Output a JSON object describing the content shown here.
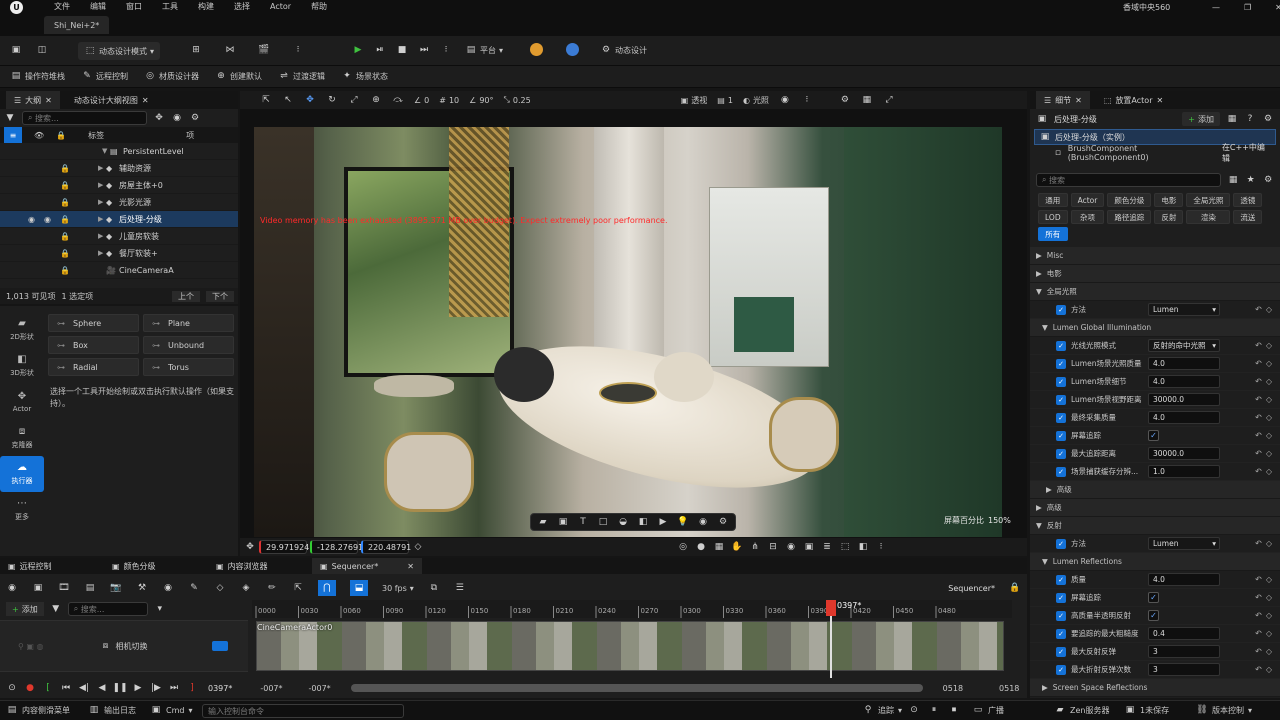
{
  "menu": {
    "items": [
      "文件",
      "编辑",
      "窗口",
      "工具",
      "构建",
      "选择",
      "Actor",
      "帮助"
    ],
    "project": "香域中央560",
    "tab": "Shi_Nei+2*"
  },
  "toolbar": {
    "mode_label": "动态设计模式",
    "platform_label": "平台",
    "dynamic_design_label": "动态设计"
  },
  "toolbar2": {
    "items": [
      "操作符堆栈",
      "远程控制",
      "材质设计器",
      "创建默认",
      "过渡逻辑",
      "场景状态"
    ]
  },
  "outliner": {
    "tab_outline": "大纲",
    "tab_dynamic": "动态设计大纲视图",
    "search_placeholder": "搜索...",
    "col_label": "标签",
    "col_item": "项",
    "rows": [
      {
        "name": "PersistentLevel",
        "indent": 0
      },
      {
        "name": "辅助资源",
        "indent": 1
      },
      {
        "name": "房屋主体+0",
        "indent": 1
      },
      {
        "name": "光影光源",
        "indent": 1
      },
      {
        "name": "后处理-分级",
        "indent": 1,
        "selected": true
      },
      {
        "name": "儿童房软装",
        "indent": 1
      },
      {
        "name": "餐厅软装+",
        "indent": 1
      },
      {
        "name": "CineCameraA",
        "indent": 1
      }
    ],
    "count_text": "1,013 可见项",
    "selected_text": "1 选定项",
    "up_label": "上个",
    "down_label": "下个"
  },
  "modes": {
    "side": [
      {
        "label": "2D形状",
        "icon": "rhombus-icon"
      },
      {
        "label": "3D形状",
        "icon": "cube-icon"
      },
      {
        "label": "Actor",
        "icon": "move-icon"
      },
      {
        "label": "克隆器",
        "icon": "clone-icon"
      },
      {
        "label": "执行器",
        "icon": "cloud-icon",
        "active": true
      },
      {
        "label": "更多",
        "icon": "dots-icon"
      }
    ],
    "shapes": [
      "Sphere",
      "Plane",
      "Box",
      "Unbound",
      "Radial",
      "Torus"
    ],
    "hint": "选择一个工具开始绘制或双击执行默认操作（如果支持）。"
  },
  "viewport": {
    "perspective": "透视",
    "lit": "光照",
    "angle": "90°",
    "snap": "10",
    "rot": "0",
    "scale": "0.25",
    "cam_speed": "1",
    "warning": "Video memory has been exhausted (3895.371 MB over budget). Expect extremely poor performance.",
    "screen_pct_label": "屏幕百分比",
    "screen_pct": "150%",
    "coords": [
      "29.971924",
      "-128.27691",
      "220.48791"
    ]
  },
  "details": {
    "tab_details": "细节",
    "tab_place": "放置Actor",
    "add_label": "添加",
    "actor_name": "后处理-分级（实例）",
    "component": "BrushComponent (BrushComponent0)",
    "edit_cpp": "在C++中编辑",
    "search_placeholder": "搜索",
    "filters": [
      "通用",
      "Actor",
      "颜色分级",
      "电影",
      "全局光照",
      "透镜",
      "LOD",
      "杂项",
      "路径追踪",
      "反射",
      "渲染",
      "流送",
      "所有"
    ],
    "sections": {
      "misc": "Misc",
      "film": "电影",
      "gi": "全局光照",
      "lumen_gi": "Lumen Global Illumination",
      "advanced": "高级",
      "advanced2": "高级",
      "reflection": "反射",
      "lumen_refl": "Lumen Reflections",
      "ssr": "Screen Space Reflections"
    },
    "gi_props": [
      {
        "name": "方法",
        "type": "dd",
        "value": "Lumen"
      }
    ],
    "lumen_gi_props": [
      {
        "name": "光线光照模式",
        "type": "dd",
        "value": "反射的命中光照"
      },
      {
        "name": "Lumen场景光照质量",
        "type": "val",
        "value": "4.0"
      },
      {
        "name": "Lumen场景细节",
        "type": "val",
        "value": "4.0"
      },
      {
        "name": "Lumen场景视野距离",
        "type": "val",
        "value": "30000.0"
      },
      {
        "name": "最终采集质量",
        "type": "val",
        "value": "4.0"
      },
      {
        "name": "屏幕追踪",
        "type": "chk",
        "value": "✓"
      },
      {
        "name": "最大追踪距离",
        "type": "val",
        "value": "30000.0"
      },
      {
        "name": "场景捕获缓存分辨...",
        "type": "val",
        "value": "1.0"
      }
    ],
    "refl_props": [
      {
        "name": "方法",
        "type": "dd",
        "value": "Lumen"
      }
    ],
    "lumen_refl_props": [
      {
        "name": "质量",
        "type": "val",
        "value": "4.0"
      },
      {
        "name": "屏幕追踪",
        "type": "chk",
        "value": "✓"
      },
      {
        "name": "高质量半透明反射",
        "type": "chk",
        "value": "✓"
      },
      {
        "name": "要追踪的最大粗糙度",
        "type": "val",
        "value": "0.4"
      },
      {
        "name": "最大反射反弹",
        "type": "val",
        "value": "3"
      },
      {
        "name": "最大折射反弹次数",
        "type": "val",
        "value": "3"
      }
    ]
  },
  "bottomtabs": [
    "远程控制",
    "颜色分级",
    "内容浏览器",
    "Sequencer*"
  ],
  "sequencer": {
    "fps": "30 fps",
    "add_label": "添加",
    "search_placeholder": "搜索...",
    "title": "Sequencer*",
    "track": "相机切换",
    "clip": "CineCameraActor0",
    "ticks": [
      "0000",
      "0030",
      "0060",
      "0090",
      "0120",
      "0150",
      "0180",
      "0210",
      "0240",
      "0270",
      "0300",
      "0330",
      "0360",
      "0390",
      "0420",
      "0450",
      "0480"
    ],
    "playhead": "0397*",
    "range_start": "-007*",
    "range_start2": "-007*",
    "range_end": "0518",
    "range_end2": "0518",
    "current": "0397*"
  },
  "status": {
    "drawer": "内容侧滑菜单",
    "log": "输出日志",
    "cmd": "Cmd",
    "cmd_placeholder": "输入控制台命令",
    "trace": "追踪",
    "broadcast": "广播",
    "zen": "Zen服务器",
    "unsaved": "1未保存",
    "version": "版本控制"
  }
}
